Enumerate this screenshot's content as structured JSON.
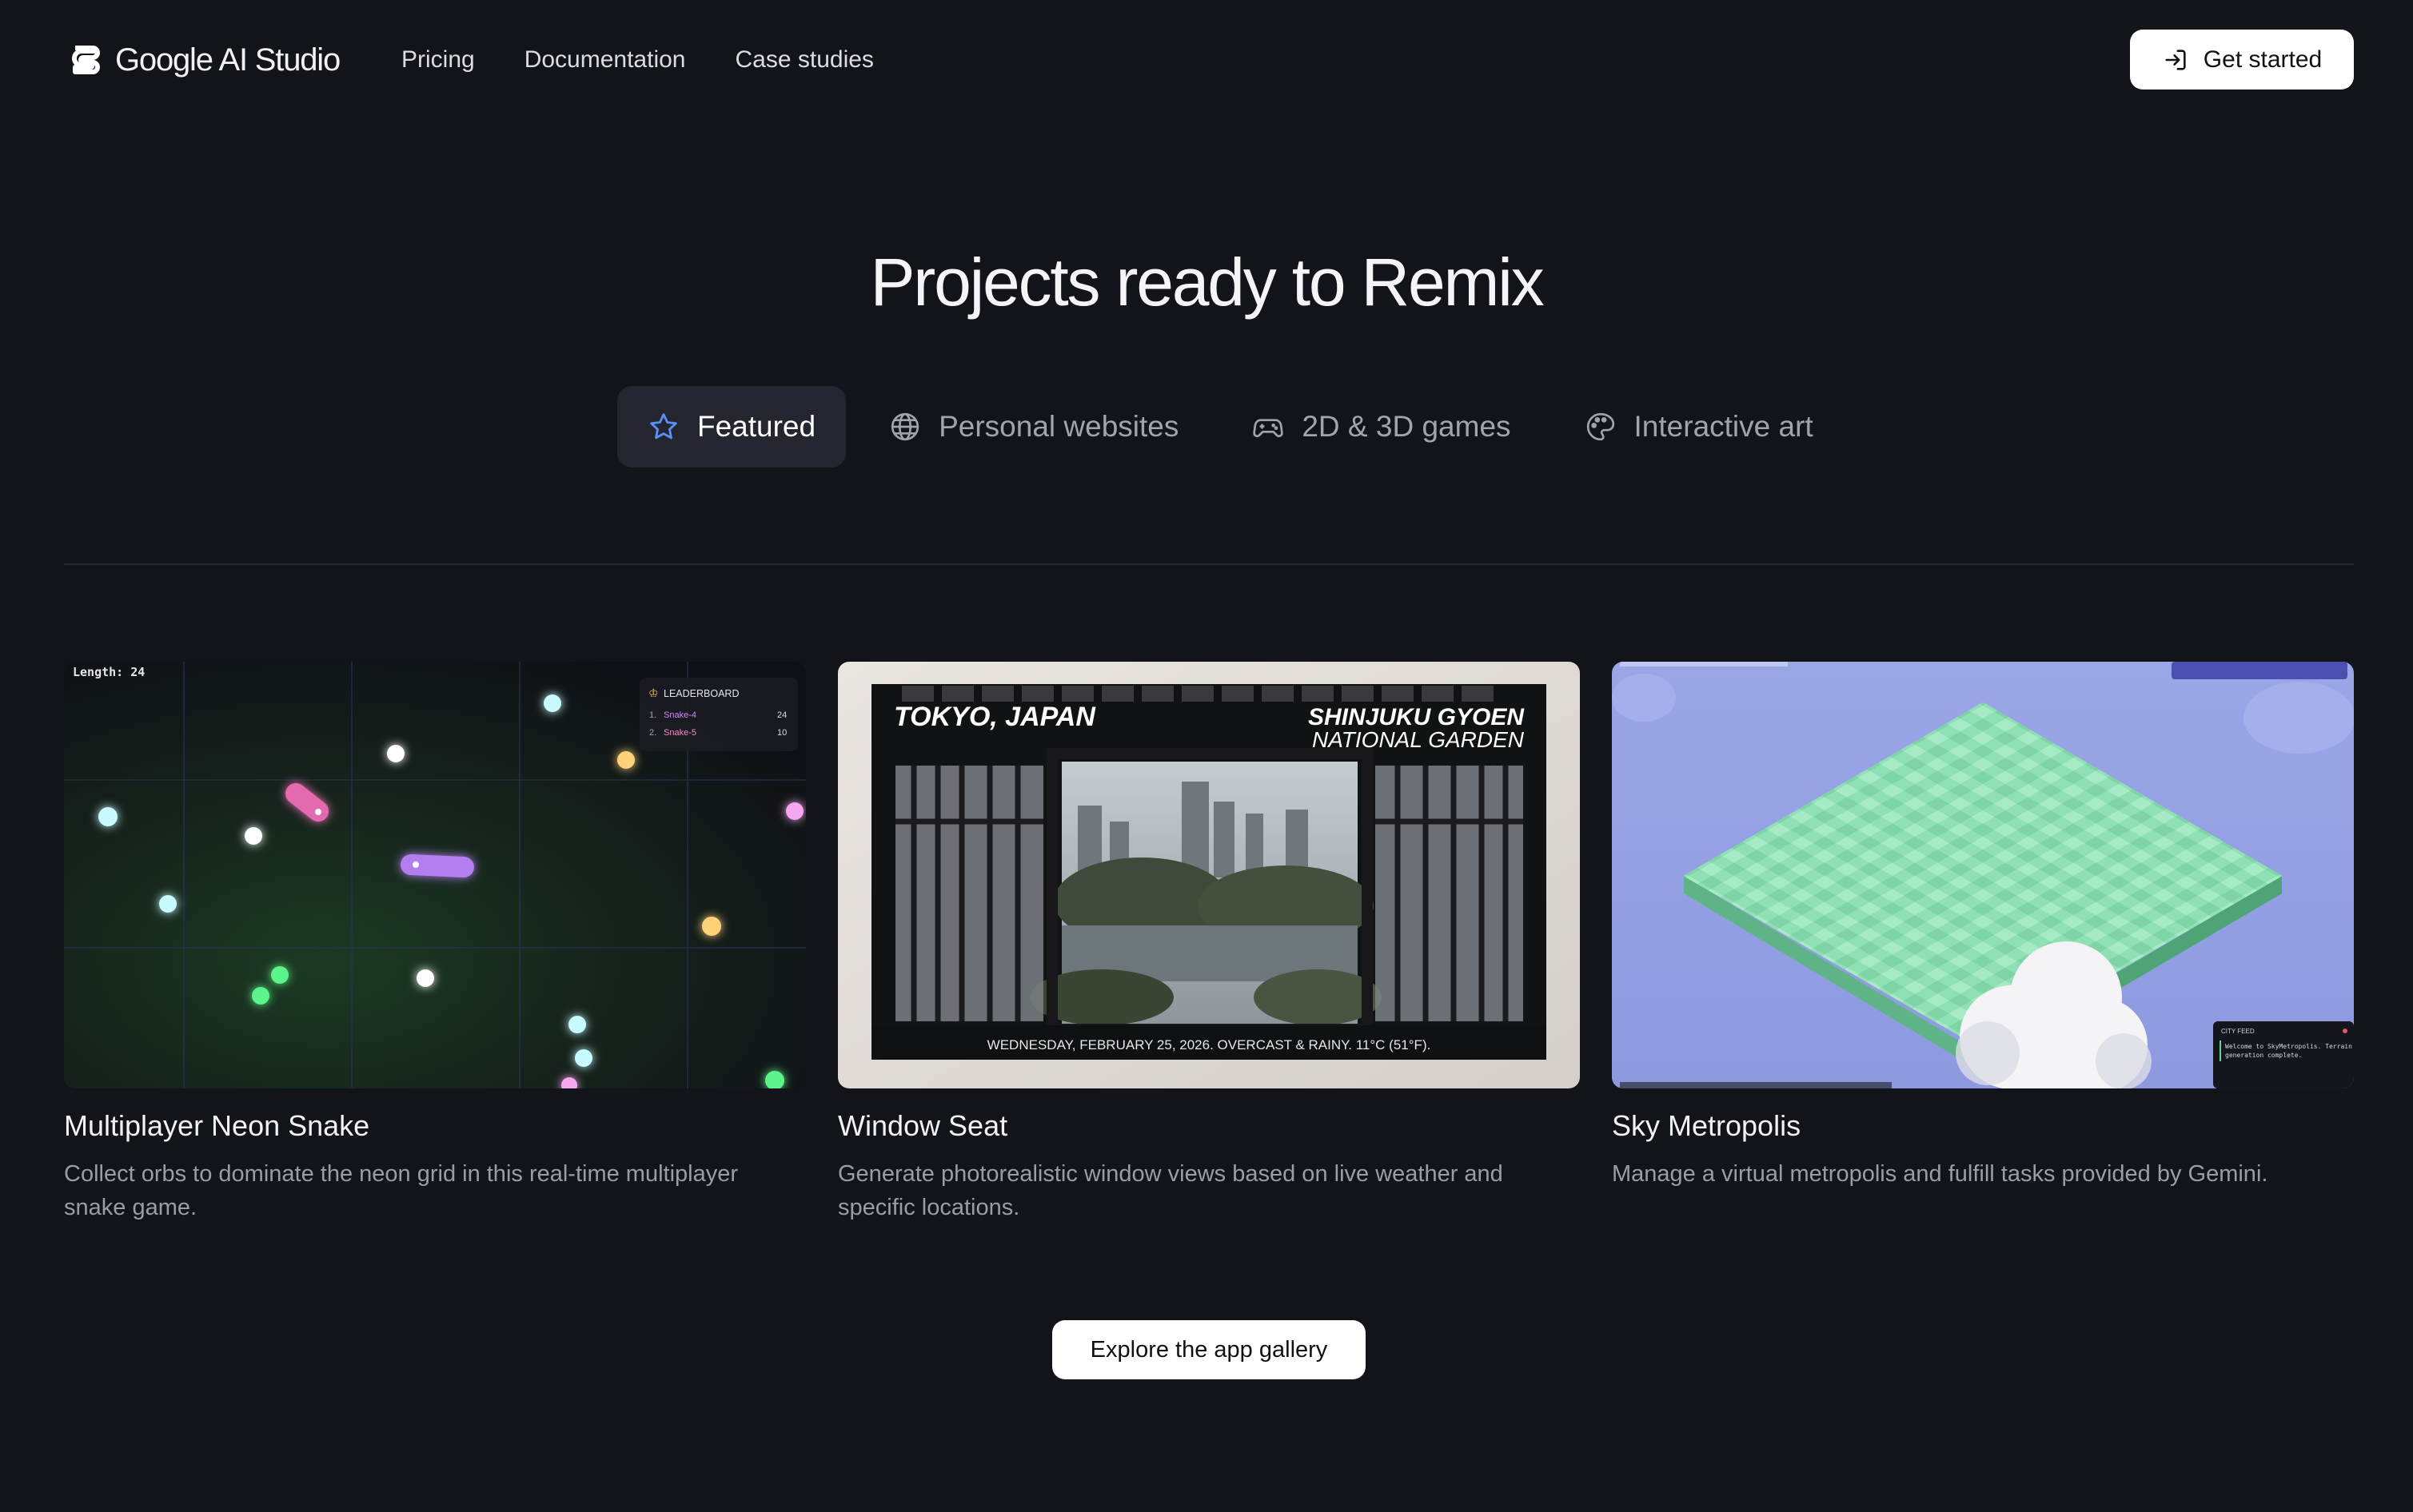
{
  "nav": {
    "brand": "Google AI Studio",
    "links": [
      {
        "label": "Pricing"
      },
      {
        "label": "Documentation"
      },
      {
        "label": "Case studies"
      }
    ],
    "cta_label": "Get started"
  },
  "hero": {
    "title": "Projects ready to Remix",
    "tabs": [
      {
        "label": "Featured",
        "icon": "star-icon",
        "active": true
      },
      {
        "label": "Personal websites",
        "icon": "globe-icon",
        "active": false
      },
      {
        "label": "2D & 3D games",
        "icon": "gamepad-icon",
        "active": false
      },
      {
        "label": "Interactive art",
        "icon": "palette-icon",
        "active": false
      }
    ]
  },
  "cards": [
    {
      "title": "Multiplayer Neon Snake",
      "description": "Collect orbs to dominate the neon grid in this real-time multiplayer snake game.",
      "thumb": {
        "length_label": "Length: 24",
        "leaderboard_title": "LEADERBOARD",
        "leaderboard": [
          {
            "rank": "1.",
            "name": "Snake-4",
            "score": "24"
          },
          {
            "rank": "2.",
            "name": "Snake-5",
            "score": "10"
          }
        ]
      }
    },
    {
      "title": "Window Seat",
      "description": "Generate photorealistic window views based on live weather and specific locations.",
      "thumb": {
        "city": "TOKYO, JAPAN",
        "place_line1": "SHINJUKU GYOEN",
        "place_line2": "NATIONAL GARDEN",
        "footer": "WEDNESDAY, FEBRUARY 25, 2026. OVERCAST & RAINY. 11°C (51°F)."
      }
    },
    {
      "title": "Sky Metropolis",
      "description": "Manage a virtual metropolis and fulfill tasks provided by Gemini.",
      "thumb": {
        "feed_title": "CITY FEED",
        "feed_text_1": "Welcome to SkyMetropolis. Terrain",
        "feed_text_2": "generation complete."
      }
    }
  ],
  "explore_label": "Explore the app gallery",
  "colors": {
    "background": "#13131a",
    "active_tab": "#252530",
    "accent_star": "#5b8ef7",
    "button_bg": "#ffffff"
  }
}
